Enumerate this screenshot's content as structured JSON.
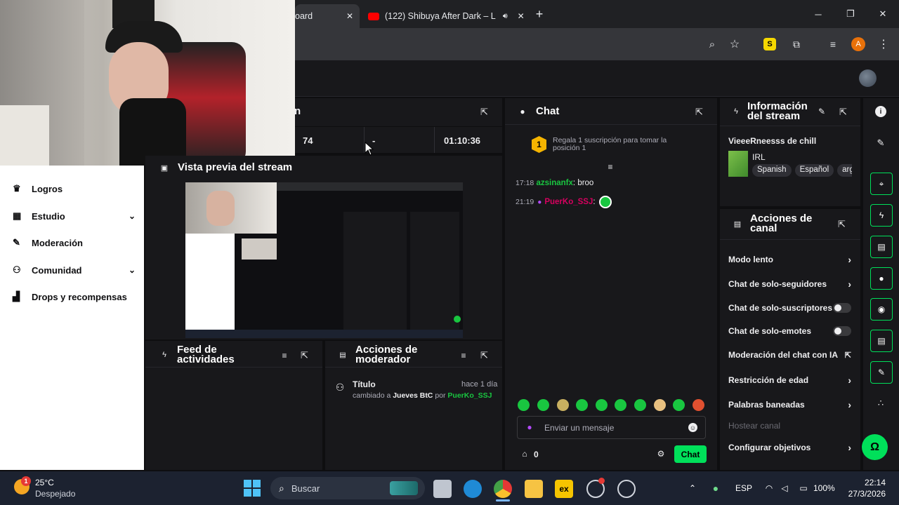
{
  "browser": {
    "tab1_title": "oard",
    "tab2_title": "(122) Shibuya After Dark – L",
    "new_tab": "+",
    "profile_initial": "A",
    "win_min": "─",
    "win_max": "❐",
    "win_close": "✕"
  },
  "stats": {
    "viewers": "74",
    "dash": "-",
    "uptime": "01:10:36"
  },
  "preview": {
    "title": "Vista previa del stream"
  },
  "sidebar": {
    "items": [
      {
        "label": "Logros"
      },
      {
        "label": "Estudio"
      },
      {
        "label": "Moderación"
      },
      {
        "label": "Comunidad"
      },
      {
        "label": "Drops y recompensas"
      }
    ]
  },
  "feed": {
    "title_l1": "Feed de",
    "title_l2": "actividades"
  },
  "modactions": {
    "title_l1": "Acciones de",
    "title_l2": "moderador",
    "entry_title": "Título",
    "entry_time": "hace 1 día",
    "entry_text_a": "cambiado a ",
    "entry_value": "Jueves BtC",
    "entry_by": " por ",
    "entry_user": "PuerKo_SSJ"
  },
  "chat": {
    "title": "Chat",
    "sub_badge": "1",
    "sub_text": "Regala 1 suscripción para tomar la posición 1",
    "messages": [
      {
        "time": "17:18",
        "user": "azsinanfx",
        "text": "broo"
      },
      {
        "time": "21:19",
        "user": "PuerKo_SSJ",
        "text": ""
      }
    ],
    "placeholder": "Enviar un mensaje",
    "points": "0",
    "send_label": "Chat",
    "colors": {
      "user1": "#19c640",
      "user2": "#d7005f",
      "accent": "#00e05a"
    }
  },
  "streaminfo": {
    "title_l1": "Información",
    "title_l2": "del stream",
    "stream_title": "VieeeRneesss de chill",
    "category": "IRL",
    "tags": [
      "Spanish",
      "Español",
      "arg"
    ]
  },
  "channel_actions": {
    "title_l1": "Acciones de",
    "title_l2": "canal",
    "items": [
      {
        "label": "Modo lento",
        "control": "chevron"
      },
      {
        "label": "Chat de solo-seguidores",
        "control": "chevron"
      },
      {
        "label": "Chat de solo-suscriptores",
        "control": "toggle"
      },
      {
        "label": "Chat de solo-emotes",
        "control": "toggle"
      },
      {
        "label": "Moderación del chat con IA",
        "control": "external"
      },
      {
        "label": "Restricción de edad",
        "control": "chevron"
      },
      {
        "label": "Palabras baneadas",
        "control": "chevron"
      },
      {
        "label": "Hostear canal",
        "control": "none"
      },
      {
        "label": "Configurar objetivos",
        "control": "chevron"
      }
    ]
  },
  "taskbar": {
    "weather_temp": "25°C",
    "weather_desc": "Despejado",
    "weather_badge": "1",
    "search_label": "Buscar",
    "lang": "ESP",
    "battery": "100%",
    "time": "22:14",
    "date": "27/3/2026"
  }
}
